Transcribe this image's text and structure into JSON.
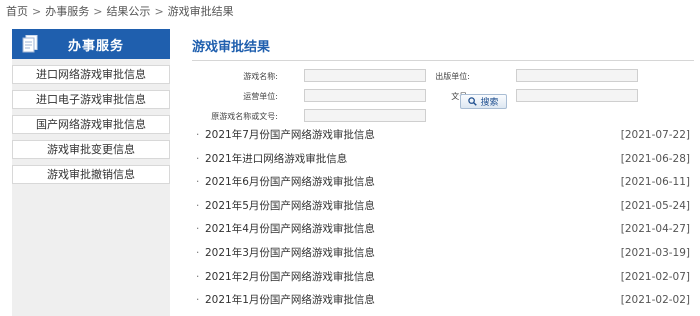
{
  "breadcrumb": [
    "首页",
    "办事服务",
    "结果公示",
    "游戏审批结果"
  ],
  "breadcrumb_separator": ">",
  "sidebar": {
    "title": "办事服务",
    "header_color": "#1f5fae",
    "icon": "document-icon",
    "items": [
      {
        "label": "进口网络游戏审批信息"
      },
      {
        "label": "进口电子游戏审批信息"
      },
      {
        "label": "国产网络游戏审批信息"
      },
      {
        "label": "游戏审批变更信息"
      },
      {
        "label": "游戏审批撤销信息"
      }
    ]
  },
  "main": {
    "title": "游戏审批结果",
    "title_color": "#1f5fae"
  },
  "form": {
    "game_name_label": "游戏名称:",
    "game_name_value": "",
    "publisher_label": "出版单位:",
    "publisher_value": "",
    "operator_label": "运营单位:",
    "operator_value": "",
    "doc_no_label": "文号:",
    "doc_no_value": "",
    "original_label": "原游戏名称或文号:",
    "original_value": "",
    "search_label": "搜索",
    "search_icon": "magnifier-icon"
  },
  "results": [
    {
      "title": "2021年7月份国产网络游戏审批信息",
      "date": "[2021-07-22]"
    },
    {
      "title": "2021年进口网络游戏审批信息",
      "date": "[2021-06-28]"
    },
    {
      "title": "2021年6月份国产网络游戏审批信息",
      "date": "[2021-06-11]"
    },
    {
      "title": "2021年5月份国产网络游戏审批信息",
      "date": "[2021-05-24]"
    },
    {
      "title": "2021年4月份国产网络游戏审批信息",
      "date": "[2021-04-27]"
    },
    {
      "title": "2021年3月份国产网络游戏审批信息",
      "date": "[2021-03-19]"
    },
    {
      "title": "2021年2月份国产网络游戏审批信息",
      "date": "[2021-02-07]"
    },
    {
      "title": "2021年1月份国产网络游戏审批信息",
      "date": "[2021-02-02]"
    }
  ],
  "bullet": "·"
}
